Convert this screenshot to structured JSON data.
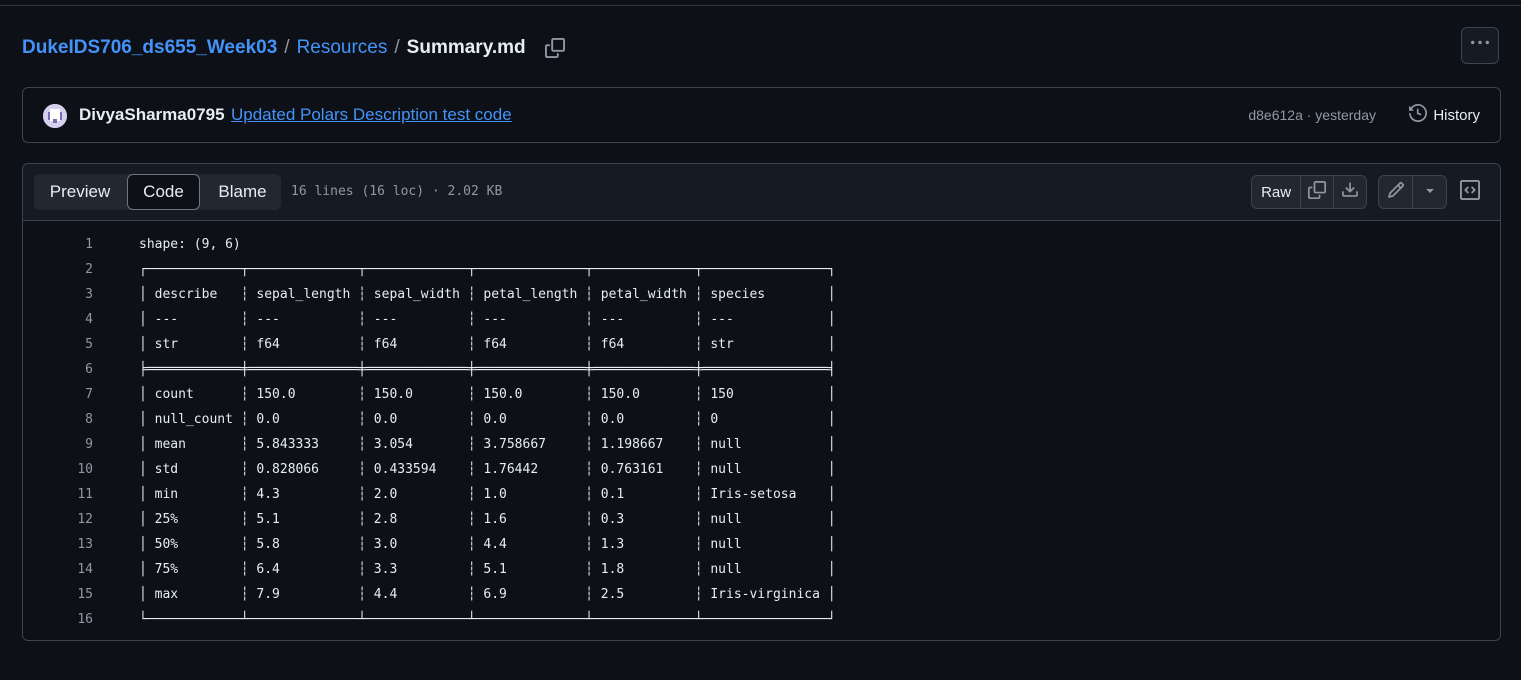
{
  "breadcrumb": {
    "repo": "DukeIDS706_ds655_Week03",
    "separator": "/",
    "folder": "Resources",
    "file": "Summary.md"
  },
  "commit": {
    "author": "DivyaSharma0795",
    "message": "Updated Polars Description test code",
    "meta": "d8e612a · yesterday",
    "history_label": "History"
  },
  "file_header": {
    "tabs": [
      "Preview",
      "Code",
      "Blame"
    ],
    "active_tab": "Code",
    "info": "16 lines (16 loc) · 2.02 KB",
    "raw_label": "Raw"
  },
  "icons": {
    "copy_path": "copy-icon",
    "more": "kebab-horizontal-icon",
    "history": "history-icon",
    "copy_raw": "copy-icon",
    "download": "download-icon",
    "edit": "pencil-icon",
    "edit_menu": "triangle-down-icon",
    "symbols": "code-square-icon"
  },
  "colors": {
    "background": "#0d1117",
    "link": "#4493f8",
    "border": "#3d444d",
    "muted": "#9198a1"
  },
  "code_lines": [
    {
      "n": "1",
      "text": "shape: (9, 6)"
    },
    {
      "n": "2",
      "text": "┌────────────┬──────────────┬─────────────┬──────────────┬─────────────┬────────────────┐"
    },
    {
      "n": "3",
      "text": "│ describe   ┆ sepal_length ┆ sepal_width ┆ petal_length ┆ petal_width ┆ species        │"
    },
    {
      "n": "4",
      "text": "│ ---        ┆ ---          ┆ ---         ┆ ---          ┆ ---         ┆ ---            │"
    },
    {
      "n": "5",
      "text": "│ str        ┆ f64          ┆ f64         ┆ f64          ┆ f64         ┆ str            │"
    },
    {
      "n": "6",
      "text": "╞════════════╪══════════════╪═════════════╪══════════════╪═════════════╪════════════════╡"
    },
    {
      "n": "7",
      "text": "│ count      ┆ 150.0        ┆ 150.0       ┆ 150.0        ┆ 150.0       ┆ 150            │"
    },
    {
      "n": "8",
      "text": "│ null_count ┆ 0.0          ┆ 0.0         ┆ 0.0          ┆ 0.0         ┆ 0              │"
    },
    {
      "n": "9",
      "text": "│ mean       ┆ 5.843333     ┆ 3.054       ┆ 3.758667     ┆ 1.198667    ┆ null           │"
    },
    {
      "n": "10",
      "text": "│ std        ┆ 0.828066     ┆ 0.433594    ┆ 1.76442      ┆ 0.763161    ┆ null           │"
    },
    {
      "n": "11",
      "text": "│ min        ┆ 4.3          ┆ 2.0         ┆ 1.0          ┆ 0.1         ┆ Iris-setosa    │"
    },
    {
      "n": "12",
      "text": "│ 25%        ┆ 5.1          ┆ 2.8         ┆ 1.6          ┆ 0.3         ┆ null           │"
    },
    {
      "n": "13",
      "text": "│ 50%        ┆ 5.8          ┆ 3.0         ┆ 4.4          ┆ 1.3         ┆ null           │"
    },
    {
      "n": "14",
      "text": "│ 75%        ┆ 6.4          ┆ 3.3         ┆ 5.1          ┆ 1.8         ┆ null           │"
    },
    {
      "n": "15",
      "text": "│ max        ┆ 7.9          ┆ 4.4         ┆ 6.9          ┆ 2.5         ┆ Iris-virginica │"
    },
    {
      "n": "16",
      "text": "└────────────┴──────────────┴─────────────┴──────────────┴─────────────┴────────────────┘"
    }
  ]
}
